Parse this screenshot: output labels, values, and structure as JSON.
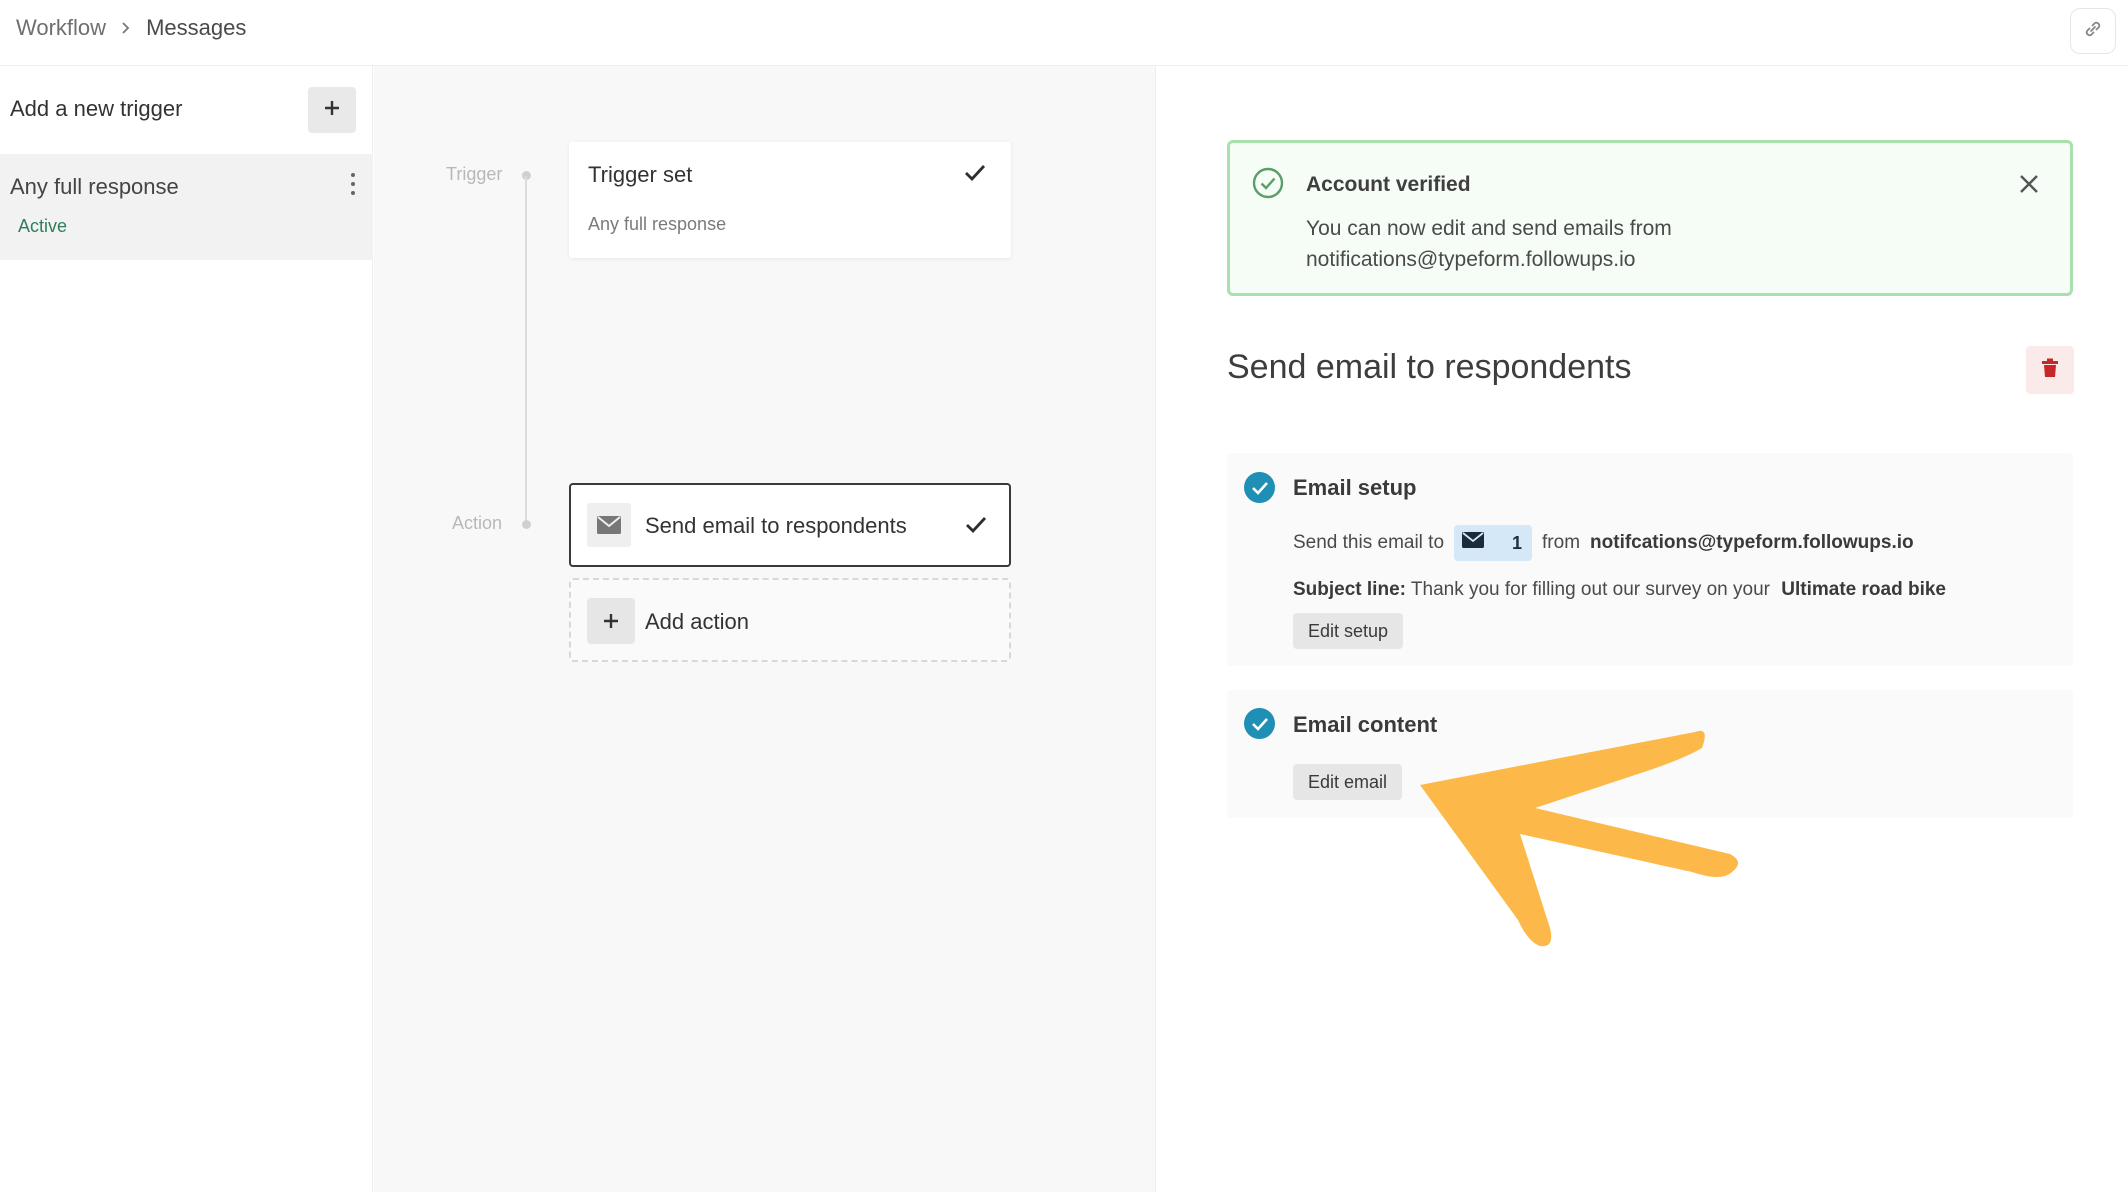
{
  "breadcrumb": {
    "root": "Workflow",
    "current": "Messages"
  },
  "sidebar": {
    "add_trigger_label": "Add a new trigger",
    "items": [
      {
        "label": "Any full response",
        "status": "Active"
      }
    ]
  },
  "canvas": {
    "trigger_step_label": "Trigger",
    "action_step_label": "Action",
    "trigger_card": {
      "title": "Trigger set",
      "subtitle": "Any full response"
    },
    "action_card": {
      "title": "Send email to respondents"
    },
    "add_action_label": "Add action"
  },
  "panel": {
    "alert": {
      "title": "Account verified",
      "body_line1": "You can now edit and send emails from",
      "body_line2": "notifications@typeform.followups.io"
    },
    "title": "Send email to respondents",
    "email_setup": {
      "title": "Email setup",
      "send_to_prefix": "Send this email to",
      "recipient_count": "1",
      "from_word": "from",
      "sender": "notifcations@typeform.followups.io",
      "subject_label": "Subject line:",
      "subject_text": "Thank you for filling out our survey on your",
      "subject_product": "Ultimate road bike",
      "edit_button": "Edit setup"
    },
    "email_content": {
      "title": "Email content",
      "edit_button": "Edit email"
    }
  },
  "colors": {
    "accent_blue": "#1f8fb5",
    "success_border": "#a9e0ad",
    "active_green": "#2e7d5b",
    "delete_red": "#c62828",
    "annotation_arrow": "#fdb84a"
  },
  "icons": {
    "breadcrumb_separator": "chevron-right-icon",
    "share": "link-icon",
    "add": "plus-icon",
    "menu": "kebab-menu-icon",
    "complete": "checkmark-icon",
    "email": "envelope-icon",
    "verified": "check-circle-icon",
    "close": "close-icon",
    "delete": "trash-icon",
    "annotation": "arrow-annotation-icon"
  }
}
